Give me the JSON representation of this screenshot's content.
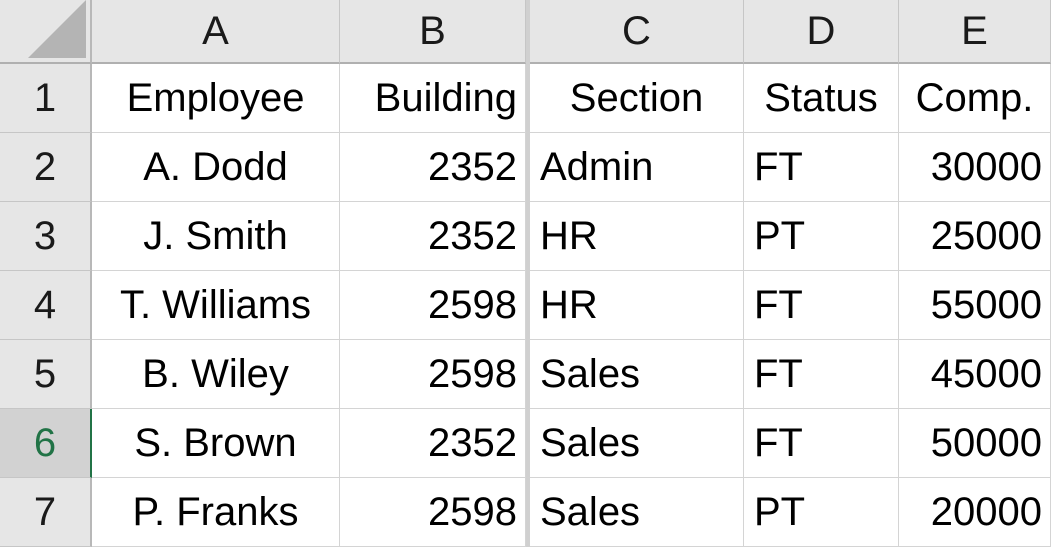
{
  "sheet": {
    "columns": [
      "A",
      "B",
      "C",
      "D",
      "E"
    ],
    "rows": [
      "1",
      "2",
      "3",
      "4",
      "5",
      "6",
      "7"
    ],
    "selected_row": "6",
    "selection_color": "#217346",
    "header_row": [
      "Employee",
      "Building",
      "Section",
      "Status",
      "Comp."
    ],
    "data": [
      [
        "A. Dodd",
        "2352",
        "Admin",
        "FT",
        "30000"
      ],
      [
        "J. Smith",
        "2352",
        "HR",
        "PT",
        "25000"
      ],
      [
        "T. Williams",
        "2598",
        "HR",
        "FT",
        "55000"
      ],
      [
        "B. Wiley",
        "2598",
        "Sales",
        "FT",
        "45000"
      ],
      [
        "S. Brown",
        "2352",
        "Sales",
        "FT",
        "50000"
      ],
      [
        "P. Franks",
        "2598",
        "Sales",
        "PT",
        "20000"
      ]
    ]
  }
}
